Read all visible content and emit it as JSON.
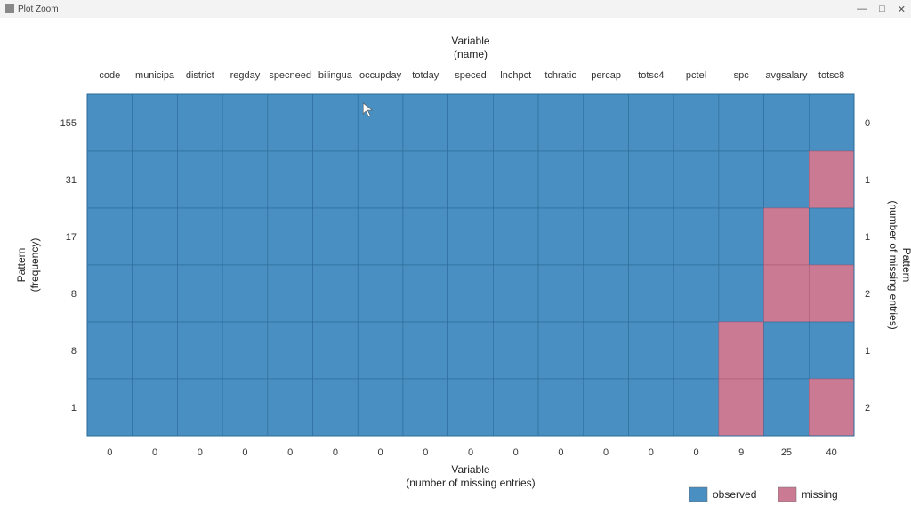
{
  "window": {
    "title": "Plot Zoom",
    "minimize": "—",
    "maximize": "□",
    "close": "✕"
  },
  "chart_data": {
    "type": "heatmap",
    "title_top_line1": "Variable",
    "title_top_line2": "(name)",
    "title_bottom_line1": "Variable",
    "title_bottom_line2": "(number of missing entries)",
    "title_left_line1": "Pattern",
    "title_left_line2": "(frequency)",
    "title_right_line1": "Pattern",
    "title_right_line2": "(number of missing entries)",
    "variables": [
      "code",
      "municipa",
      "district",
      "regday",
      "specneed",
      "bilingua",
      "occupday",
      "totday",
      "speced",
      "lnchpct",
      "tchratio",
      "percap",
      "totsc4",
      "pctel",
      "spc",
      "avgsalary",
      "totsc8"
    ],
    "missing_totals_per_variable": [
      0,
      0,
      0,
      0,
      0,
      0,
      0,
      0,
      0,
      0,
      0,
      0,
      0,
      0,
      9,
      25,
      40
    ],
    "pattern_frequency": [
      155,
      31,
      17,
      8,
      8,
      1
    ],
    "pattern_missing_count": [
      0,
      1,
      1,
      2,
      1,
      2
    ],
    "matrix": [
      [
        0,
        0,
        0,
        0,
        0,
        0,
        0,
        0,
        0,
        0,
        0,
        0,
        0,
        0,
        0,
        0,
        0
      ],
      [
        0,
        0,
        0,
        0,
        0,
        0,
        0,
        0,
        0,
        0,
        0,
        0,
        0,
        0,
        0,
        0,
        1
      ],
      [
        0,
        0,
        0,
        0,
        0,
        0,
        0,
        0,
        0,
        0,
        0,
        0,
        0,
        0,
        0,
        1,
        0
      ],
      [
        0,
        0,
        0,
        0,
        0,
        0,
        0,
        0,
        0,
        0,
        0,
        0,
        0,
        0,
        0,
        1,
        1
      ],
      [
        0,
        0,
        0,
        0,
        0,
        0,
        0,
        0,
        0,
        0,
        0,
        0,
        0,
        0,
        1,
        0,
        0
      ],
      [
        0,
        0,
        0,
        0,
        0,
        0,
        0,
        0,
        0,
        0,
        0,
        0,
        0,
        0,
        1,
        0,
        1
      ]
    ],
    "legend": {
      "observed": {
        "label": "observed",
        "color": "#4a8fc1"
      },
      "missing": {
        "label": "missing",
        "color": "#ca7b93"
      }
    },
    "colors": {
      "observed": "#4a8fc1",
      "missing": "#ca7b93"
    },
    "cursor_position": {
      "col_index": 6,
      "row_index": 0
    }
  }
}
